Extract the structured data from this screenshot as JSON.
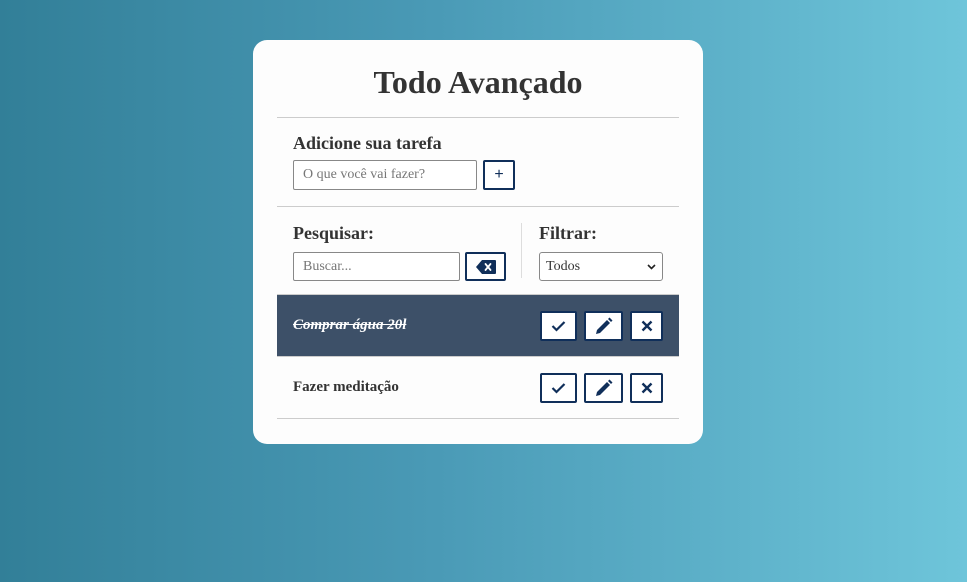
{
  "app": {
    "title": "Todo Avançado"
  },
  "add_form": {
    "label": "Adicione sua tarefa",
    "input_placeholder": "O que você vai fazer?",
    "add_button_label": "+"
  },
  "search": {
    "label": "Pesquisar:",
    "placeholder": "Buscar...",
    "erase_icon": "backspace-icon"
  },
  "filter": {
    "label": "Filtrar:",
    "selected": "Todos"
  },
  "todos": [
    {
      "text": "Comprar água 20l",
      "done": true
    },
    {
      "text": "Fazer meditação",
      "done": false
    }
  ],
  "colors": {
    "accent": "#102f5a",
    "done_row": "#3d5068",
    "gradient_start": "#327f98",
    "gradient_end": "#6ec5da"
  }
}
